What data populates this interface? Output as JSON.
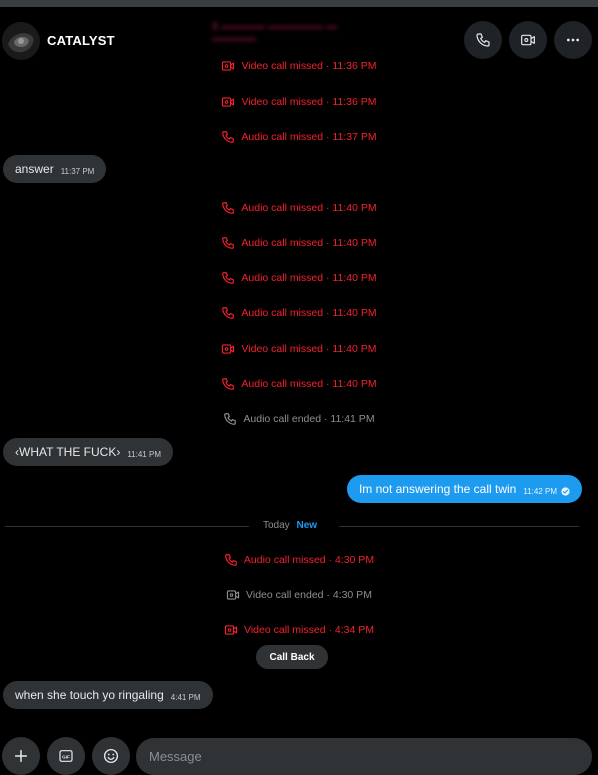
{
  "header": {
    "contact_name": "CATALYST",
    "icons": [
      "phone-icon",
      "video-icon",
      "more-icon"
    ]
  },
  "events_top": [
    {
      "kind": "missed",
      "icon": "video-icon",
      "label": "Video call missed · 11:36 PM"
    },
    {
      "kind": "missed",
      "icon": "video-icon",
      "label": "Video call missed · 11:36 PM"
    },
    {
      "kind": "missed",
      "icon": "phone-icon",
      "label": "Audio call missed · 11:37 PM"
    }
  ],
  "messages": {
    "answer": {
      "text": "answer",
      "time": "11:37 PM"
    },
    "wtf": {
      "text": "‹WHAT THE FUCK›",
      "time": "11:41 PM"
    },
    "outgoing": {
      "text": "Im not answering the call twin",
      "time": "11:42 PM"
    },
    "ringaling": {
      "text": "when she touch yo ringaling",
      "time": "4:41 PM"
    }
  },
  "events_mid": [
    {
      "kind": "missed",
      "icon": "phone-icon",
      "label": "Audio call missed · 11:40 PM"
    },
    {
      "kind": "missed",
      "icon": "phone-icon",
      "label": "Audio call missed · 11:40 PM"
    },
    {
      "kind": "missed",
      "icon": "phone-icon",
      "label": "Audio call missed · 11:40 PM"
    },
    {
      "kind": "missed",
      "icon": "phone-icon",
      "label": "Audio call missed · 11:40 PM"
    },
    {
      "kind": "missed",
      "icon": "video-icon",
      "label": "Video call missed · 11:40 PM"
    },
    {
      "kind": "missed",
      "icon": "phone-icon",
      "label": "Audio call missed · 11:40 PM"
    },
    {
      "kind": "ended",
      "icon": "phone-icon",
      "label": "Audio call ended · 11:41 PM"
    }
  ],
  "divider": {
    "label": "Today",
    "badge": "New"
  },
  "events_today": [
    {
      "kind": "missed",
      "icon": "phone-icon",
      "label": "Audio call missed · 4:30 PM"
    },
    {
      "kind": "ended",
      "icon": "video-icon",
      "label": "Video call ended · 4:30 PM"
    },
    {
      "kind": "missed",
      "icon": "video-icon",
      "label": "Video call missed · 4:34 PM"
    }
  ],
  "callback_label": "Call Back",
  "composer": {
    "placeholder": "Message",
    "icons": [
      "plus-icon",
      "gif-icon",
      "emoji-icon"
    ]
  },
  "colors": {
    "missed": "#f4212e",
    "ended": "#8b8f94",
    "accent": "#1d9bf0",
    "bubble_in": "#2f3336"
  }
}
